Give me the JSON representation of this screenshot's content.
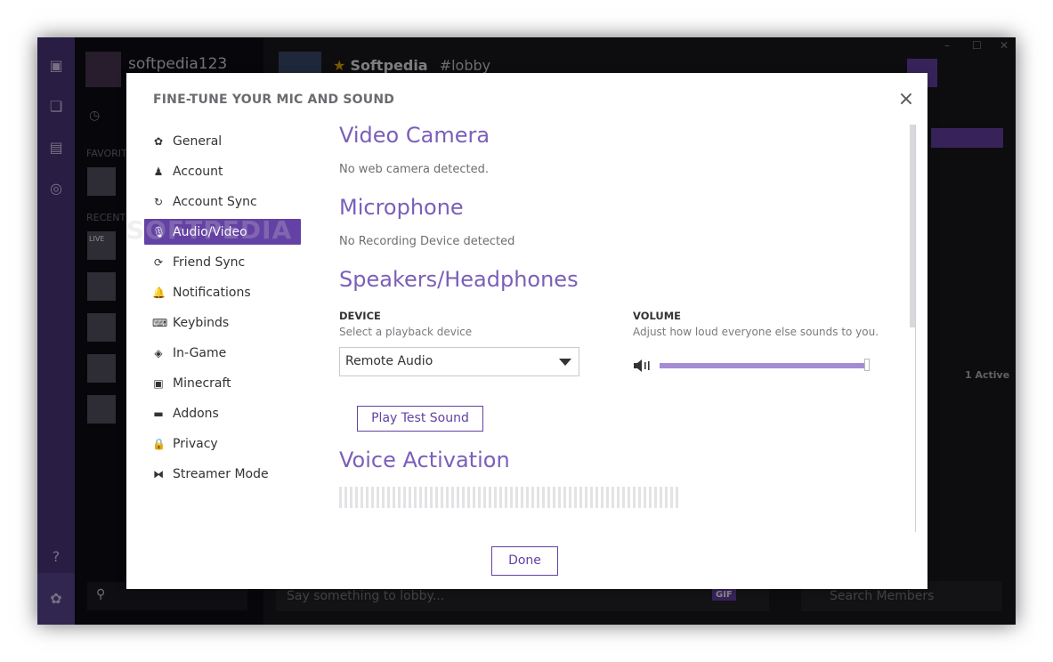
{
  "background_app": {
    "username": "softpedia123",
    "sections": {
      "favorites": "FAVORIT",
      "recent": "RECENT"
    },
    "live_badge": "LIVE",
    "channel": {
      "star": "★",
      "name": "Softpedia",
      "room": "#lobby"
    },
    "chat_placeholder": "Say something to lobby...",
    "gif_label": "GIF",
    "members_search_placeholder": "Search Members",
    "active_count": "1 Active",
    "window_controls": [
      "–",
      "☐",
      "✕"
    ],
    "colors": {
      "rail": "#4b367c",
      "accent": "#6441a4"
    }
  },
  "modal": {
    "title": "FINE-TUNE YOUR MIC AND SOUND",
    "close_label": "×",
    "watermark": "SOFTPEDIA",
    "nav": [
      {
        "label": "General",
        "icon": "gear-icon",
        "glyph": "✿"
      },
      {
        "label": "Account",
        "icon": "user-icon",
        "glyph": "♟"
      },
      {
        "label": "Account Sync",
        "icon": "sync-icon",
        "glyph": "↻"
      },
      {
        "label": "Audio/Video",
        "icon": "microphone-icon",
        "glyph": "🎙",
        "active": true
      },
      {
        "label": "Friend Sync",
        "icon": "friend-sync-icon",
        "glyph": "⟳"
      },
      {
        "label": "Notifications",
        "icon": "bell-icon",
        "glyph": "🔔"
      },
      {
        "label": "Keybinds",
        "icon": "keyboard-icon",
        "glyph": "⌨"
      },
      {
        "label": "In-Game",
        "icon": "layers-icon",
        "glyph": "◈"
      },
      {
        "label": "Minecraft",
        "icon": "minecraft-icon",
        "glyph": "▣"
      },
      {
        "label": "Addons",
        "icon": "addons-icon",
        "glyph": "▬"
      },
      {
        "label": "Privacy",
        "icon": "lock-icon",
        "glyph": "🔒"
      },
      {
        "label": "Streamer Mode",
        "icon": "streamer-icon",
        "glyph": "⧓"
      }
    ],
    "video_camera": {
      "title": "Video Camera",
      "status": "No web camera detected."
    },
    "microphone": {
      "title": "Microphone",
      "status": "No Recording Device detected"
    },
    "speakers": {
      "title": "Speakers/Headphones",
      "device_label": "DEVICE",
      "device_hint": "Select a playback device",
      "device_value": "Remote Audio",
      "volume_label": "VOLUME",
      "volume_hint": "Adjust how loud everyone else sounds to you.",
      "volume_level": 1.0,
      "test_button": "Play Test Sound"
    },
    "voice_activation": {
      "title": "Voice Activation"
    },
    "done_button": "Done",
    "colors": {
      "accent": "#6441a4",
      "heading": "#7b5fb8",
      "slider": "#b59fdc"
    }
  }
}
